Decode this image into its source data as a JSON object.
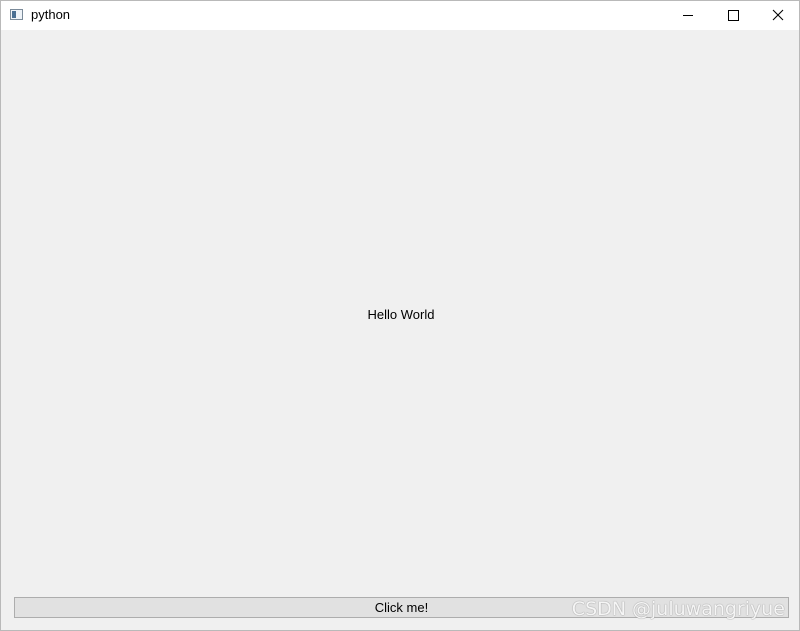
{
  "window": {
    "title": "python",
    "icon": "window-app-icon",
    "controls": {
      "minimize": "minimize-icon",
      "maximize": "maximize-icon",
      "close": "close-icon"
    }
  },
  "main": {
    "label_text": "Hello World",
    "button_label": "Click me!"
  },
  "watermark": {
    "text": "CSDN @juluwangriyue"
  },
  "colors": {
    "titlebar": "#ffffff",
    "client_background": "#f0f0f0",
    "button_face": "#e1e1e1",
    "button_border": "#adadad"
  }
}
